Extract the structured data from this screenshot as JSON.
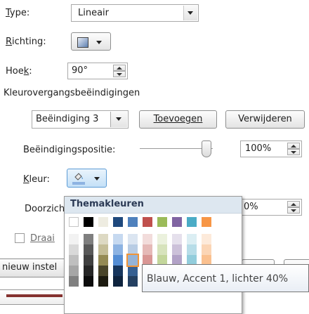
{
  "type": {
    "label": "Type:",
    "value": "Lineair"
  },
  "richting": {
    "label": "Richting:"
  },
  "hoek": {
    "label": "Hoek:",
    "value": "90°"
  },
  "gradient_stops": {
    "heading": "Kleurovergangsbeëindigingen",
    "selected": "Beëindiging 3",
    "add_button": "Toevoegen",
    "remove_button": "Verwijderen"
  },
  "position": {
    "label": "Beëindigingspositie:",
    "value": "100%",
    "level_percent": 100
  },
  "kleur": {
    "label": "Kleur:"
  },
  "transparency": {
    "label": "Doorzicht",
    "value": "0%"
  },
  "rotate_checkbox": {
    "label": "Draai"
  },
  "reset_button": {
    "label": "nieuw instel"
  },
  "palette": {
    "heading": "Themakleuren",
    "theme_colors": [
      "#FFFFFF",
      "#000000",
      "#EEECE1",
      "#1F497D",
      "#4F81BD",
      "#C0504D",
      "#9BBB59",
      "#8064A2",
      "#4BACC6",
      "#F79646"
    ],
    "shade_columns": [
      [
        "#F2F2F2",
        "#D9D9D9",
        "#BFBFBF",
        "#A6A6A6",
        "#808080"
      ],
      [
        "#7F7F7F",
        "#595959",
        "#404040",
        "#262626",
        "#0D0D0D"
      ],
      [
        "#DDD9C3",
        "#C4BD97",
        "#948A54",
        "#4A452A",
        "#1D1B10"
      ],
      [
        "#C6D9F0",
        "#8DB3E2",
        "#548DD4",
        "#17365D",
        "#0F243E"
      ],
      [
        "#DBE5F1",
        "#B8CCE4",
        "#95B3D7",
        "#366092",
        "#244061"
      ],
      [
        "#F2DCDB",
        "#E5B9B7",
        "#D99694",
        "#953734",
        "#632423"
      ],
      [
        "#EBF1DD",
        "#D7E3BC",
        "#C3D69B",
        "#76923C",
        "#4F6128"
      ],
      [
        "#E5E0EC",
        "#CCC1D9",
        "#B2A2C7",
        "#5F497A",
        "#3F3151"
      ],
      [
        "#DBEEF3",
        "#B7DDE8",
        "#92CDDC",
        "#31859B",
        "#205867"
      ],
      [
        "#FDEADA",
        "#FBD5B5",
        "#FAC08F",
        "#E36C09",
        "#974806"
      ]
    ],
    "hovered_swatch": "Blauw, Accent 1, lichter 40%"
  },
  "tooltip": "Blauw, Accent 1, lichter 40%"
}
